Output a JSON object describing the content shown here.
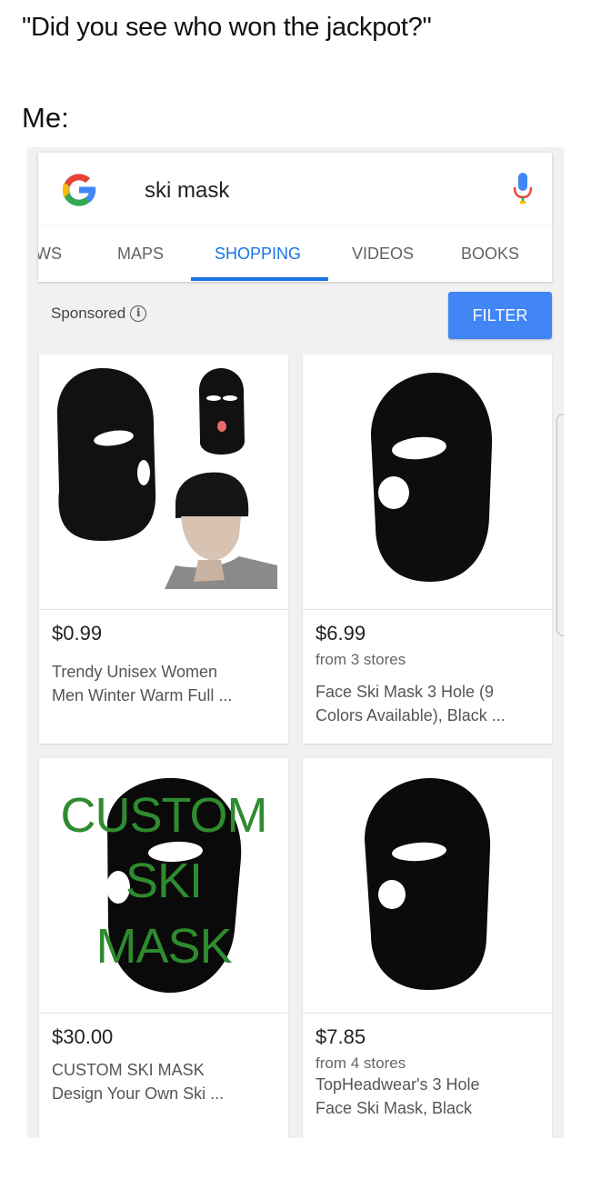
{
  "meme": {
    "caption": "\"Did you see who won the jackpot?\"",
    "me": "Me:"
  },
  "search": {
    "query": "ski mask",
    "logo_icon": "google-g-icon",
    "mic_icon": "microphone-icon"
  },
  "tabs": [
    {
      "label": "WS",
      "active": false
    },
    {
      "label": "MAPS",
      "active": false
    },
    {
      "label": "SHOPPING",
      "active": true
    },
    {
      "label": "VIDEOS",
      "active": false
    },
    {
      "label": "BOOKS",
      "active": false
    }
  ],
  "toolbar": {
    "sponsored_label": "Sponsored",
    "info_icon": "info-icon",
    "filter_label": "FILTER"
  },
  "products": [
    {
      "price": "$0.99",
      "from": "",
      "title_line1": "Trendy Unisex Women",
      "title_line2": "Men Winter Warm Full ..."
    },
    {
      "price": "$6.99",
      "from": "from 3 stores",
      "title_line1": "Face Ski Mask 3 Hole (9",
      "title_line2": "Colors Available), Black ..."
    },
    {
      "price": "$30.00",
      "from": "",
      "title_line1": "CUSTOM SKI MASK",
      "title_line2": "Design Your Own Ski ...",
      "image_text": [
        "CUSTOM",
        "SKI",
        "MASK"
      ]
    },
    {
      "price": "$7.85",
      "from": "from 4 stores",
      "title_line1": "TopHeadwear's 3 Hole",
      "title_line2": "Face Ski Mask, Black"
    }
  ],
  "colors": {
    "accent_blue": "#1a73e8",
    "filter_blue": "#4285f4",
    "custom_text_green": "#2e8b2e"
  }
}
